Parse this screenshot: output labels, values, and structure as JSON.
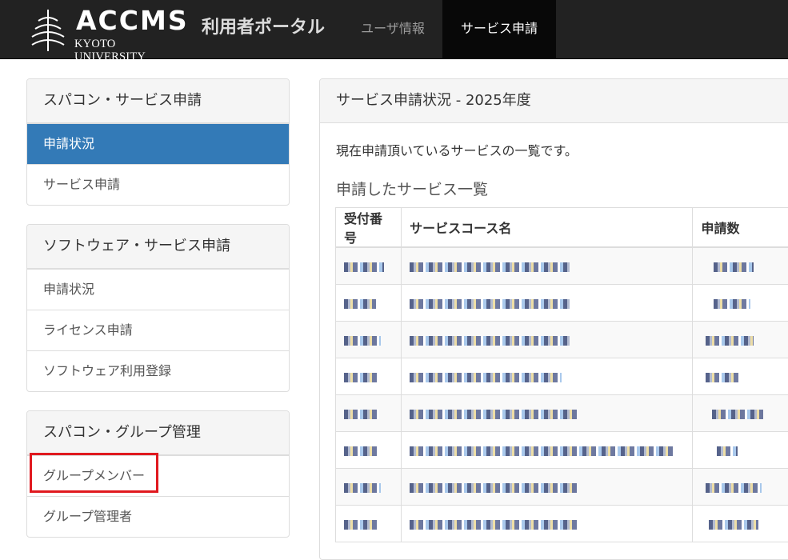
{
  "navbar": {
    "brand_main": "ACCMS",
    "brand_sub": "KYOTO UNIVERSITY",
    "portal_title": "利用者ポータル",
    "nav_user": "ユーザ情報",
    "nav_service": "サービス申請"
  },
  "sidebar": {
    "panel1": {
      "heading": "スパコン・サービス申請",
      "items": [
        {
          "label": "申請状況",
          "active": true
        },
        {
          "label": "サービス申請",
          "active": false
        }
      ]
    },
    "panel2": {
      "heading": "ソフトウェア・サービス申請",
      "items": [
        {
          "label": "申請状況"
        },
        {
          "label": "ライセンス申請"
        },
        {
          "label": "ソフトウェア利用登録"
        }
      ]
    },
    "panel3": {
      "heading": "スパコン・グループ管理",
      "items": [
        {
          "label": "グループメンバー"
        },
        {
          "label": "グループ管理者"
        }
      ]
    }
  },
  "main": {
    "heading": "サービス申請状況 - 2025年度",
    "description": "現在申請頂いているサービスの一覧です。",
    "subtitle": "申請したサービス一覧",
    "table": {
      "headers": [
        "受付番号",
        "サービスコース名",
        "申請数"
      ]
    }
  },
  "colors": {
    "navbar_bg": "#222222",
    "active_blue": "#337ab7",
    "highlight_red": "#e0191f"
  }
}
